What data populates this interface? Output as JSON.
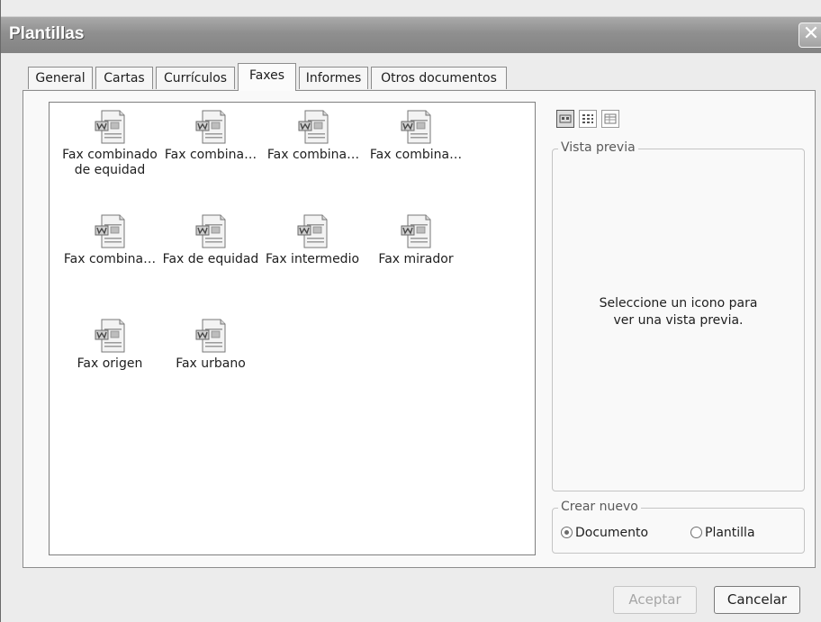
{
  "window": {
    "title": "Plantillas",
    "close_glyph": "✕"
  },
  "tabs": [
    {
      "label": "General"
    },
    {
      "label": "Cartas"
    },
    {
      "label": "Currículos"
    },
    {
      "label": "Faxes"
    },
    {
      "label": "Informes"
    },
    {
      "label": "Otros documentos"
    }
  ],
  "active_tab": "Faxes",
  "templates": [
    {
      "label": "Fax combinado de equidad",
      "icon": "word-document-icon"
    },
    {
      "label": "Fax combina…",
      "icon": "word-document-icon"
    },
    {
      "label": "Fax combina…",
      "icon": "word-document-icon"
    },
    {
      "label": "Fax combina…",
      "icon": "word-document-icon"
    },
    {
      "label": "Fax combina…",
      "icon": "word-document-icon"
    },
    {
      "label": "Fax de equidad",
      "icon": "word-document-icon"
    },
    {
      "label": "Fax intermedio",
      "icon": "word-document-icon"
    },
    {
      "label": "Fax mirador",
      "icon": "word-document-icon"
    },
    {
      "label": "Fax origen",
      "icon": "word-document-icon"
    },
    {
      "label": "Fax urbano",
      "icon": "word-document-icon"
    }
  ],
  "view_buttons": [
    {
      "icon": "large-icons-view-icon",
      "active": true
    },
    {
      "icon": "list-view-icon",
      "active": false
    },
    {
      "icon": "details-view-icon",
      "active": false
    }
  ],
  "preview": {
    "title": "Vista previa",
    "message_line1": "Seleccione un icono para",
    "message_line2": "ver una vista previa."
  },
  "create_new": {
    "title": "Crear nuevo",
    "option_document": "Documento",
    "option_template": "Plantilla",
    "selected": "Documento"
  },
  "buttons": {
    "accept": "Aceptar",
    "cancel": "Cancelar"
  }
}
